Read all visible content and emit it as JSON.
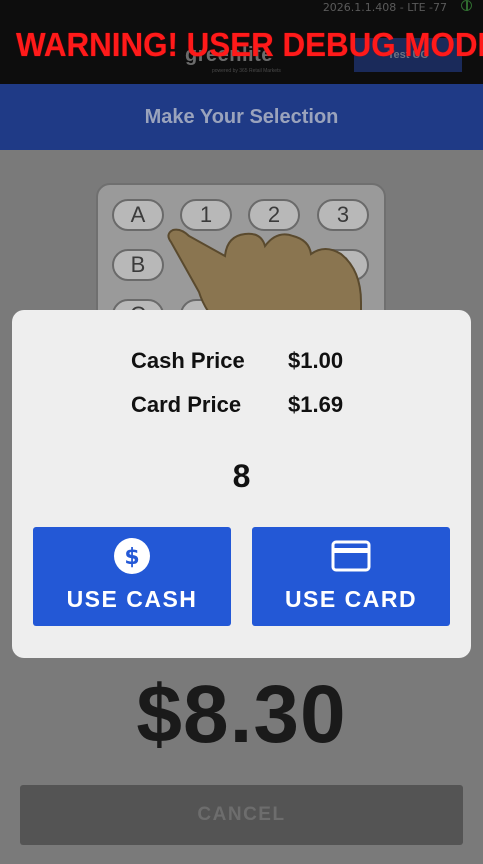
{
  "status_bar": {
    "text": "2026.1.1.408 - LTE -77"
  },
  "header": {
    "logo": "greenlite",
    "logo_tagline": "powered by 365 Retail Markets",
    "test_button": "Test UC",
    "warning": "WARNING! USER DEBUG MODE",
    "selection_title": "Make Your Selection"
  },
  "keypad": {
    "keys": [
      "A",
      "1",
      "2",
      "3",
      "B",
      "",
      "",
      "6",
      "C",
      "",
      "",
      ""
    ]
  },
  "modal": {
    "cash_label": "Cash Price",
    "cash_value": "$1.00",
    "card_label": "Card Price",
    "card_value": "$1.69",
    "selection_number": "8",
    "use_cash": "USE CASH",
    "use_card": "USE CARD"
  },
  "total": "$8.30",
  "cancel_label": "CANCEL",
  "colors": {
    "accent_blue": "#2358d6",
    "warning_red": "#ff1a1a",
    "selection_bar": "#1f3a86"
  }
}
